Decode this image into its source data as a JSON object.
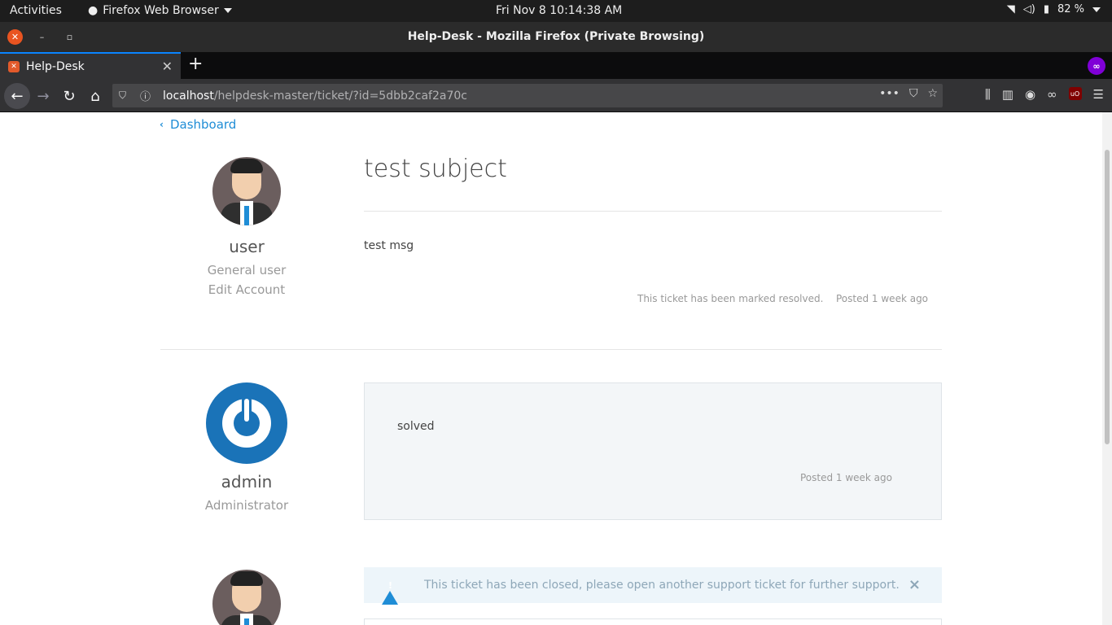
{
  "system": {
    "activities": "Activities",
    "app_name": "Firefox Web Browser",
    "clock": "Fri Nov 8  10:14:38 AM",
    "battery": "82 %"
  },
  "window": {
    "title": "Help-Desk - Mozilla Firefox (Private Browsing)"
  },
  "browser": {
    "tab_label": "Help-Desk",
    "url_host": "localhost",
    "url_path": "/helpdesk-master/ticket/?id=5dbb2caf2a70c"
  },
  "page": {
    "back_link": "Dashboard",
    "ticket": {
      "author_name": "user",
      "author_role": "General user",
      "author_edit": "Edit Account",
      "subject": "test subject",
      "message": "test msg",
      "status_note": "This ticket has been marked resolved.",
      "posted": "Posted 1 week ago"
    },
    "reply": {
      "author_name": "admin",
      "author_role": "Administrator",
      "message": "solved",
      "posted": "Posted 1 week ago"
    },
    "alert": {
      "text": "This ticket has been closed, please open another support ticket for further support.",
      "close": "×"
    }
  },
  "colors": {
    "link": "#1f8dd6",
    "accent_orange": "#e95420",
    "private_purple": "#8000d7"
  }
}
